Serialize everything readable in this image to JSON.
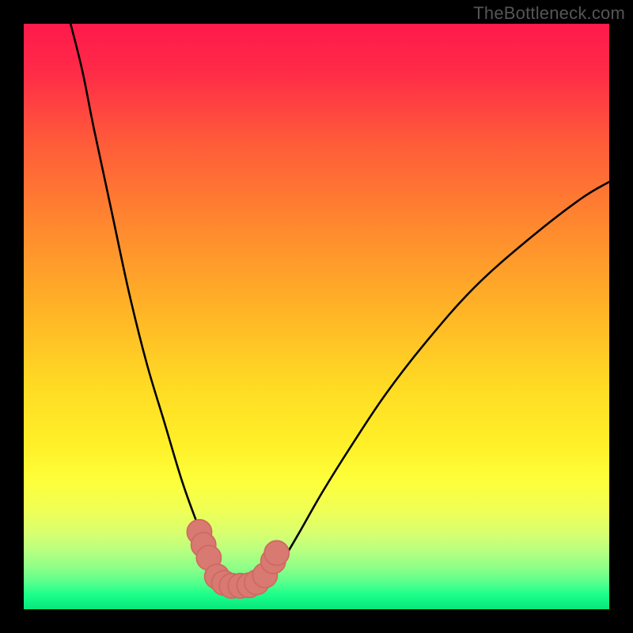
{
  "watermark": "TheBottleneck.com",
  "colors": {
    "frame": "#000000",
    "curve": "#000000",
    "marker_fill": "#d87a72",
    "marker_stroke": "#cf6a62",
    "gradient_stops": [
      {
        "offset": 0.0,
        "color": "#ff1a4b"
      },
      {
        "offset": 0.08,
        "color": "#ff2a48"
      },
      {
        "offset": 0.2,
        "color": "#ff5a3a"
      },
      {
        "offset": 0.35,
        "color": "#ff8a2e"
      },
      {
        "offset": 0.5,
        "color": "#ffb726"
      },
      {
        "offset": 0.62,
        "color": "#ffdb24"
      },
      {
        "offset": 0.72,
        "color": "#fff028"
      },
      {
        "offset": 0.78,
        "color": "#fdff3a"
      },
      {
        "offset": 0.83,
        "color": "#f0ff55"
      },
      {
        "offset": 0.87,
        "color": "#d8ff70"
      },
      {
        "offset": 0.9,
        "color": "#b8ff80"
      },
      {
        "offset": 0.93,
        "color": "#8cff88"
      },
      {
        "offset": 0.955,
        "color": "#55ff8c"
      },
      {
        "offset": 0.975,
        "color": "#1aff8a"
      },
      {
        "offset": 1.0,
        "color": "#07e77a"
      }
    ]
  },
  "chart_data": {
    "type": "line",
    "title": "",
    "xlabel": "",
    "ylabel": "",
    "xlim": [
      0,
      100
    ],
    "ylim": [
      0,
      100
    ],
    "series": [
      {
        "name": "left-curve",
        "x": [
          8,
          10,
          12,
          15,
          18,
          21,
          24,
          27,
          29.5,
          31.5,
          33,
          34,
          35,
          36,
          37.5
        ],
        "y": [
          100,
          92,
          82,
          68,
          54,
          42,
          32,
          22,
          15,
          10,
          7,
          5.5,
          4.5,
          4,
          4
        ]
      },
      {
        "name": "right-curve",
        "x": [
          37.5,
          39,
          40.5,
          42,
          44,
          47,
          51,
          56,
          62,
          69,
          77,
          86,
          95,
          100
        ],
        "y": [
          4,
          4,
          4.5,
          5.5,
          8,
          13,
          20,
          28,
          37,
          46,
          55,
          63,
          70,
          73
        ]
      }
    ],
    "markers": {
      "name": "valley-markers",
      "points": [
        {
          "x": 30.0,
          "y": 13.2
        },
        {
          "x": 30.7,
          "y": 11.0
        },
        {
          "x": 31.6,
          "y": 8.8
        },
        {
          "x": 33.0,
          "y": 5.6
        },
        {
          "x": 34.2,
          "y": 4.5
        },
        {
          "x": 35.5,
          "y": 4.0
        },
        {
          "x": 37.0,
          "y": 4.0
        },
        {
          "x": 38.5,
          "y": 4.1
        },
        {
          "x": 39.8,
          "y": 4.6
        },
        {
          "x": 41.2,
          "y": 5.8
        },
        {
          "x": 42.6,
          "y": 8.2
        },
        {
          "x": 43.2,
          "y": 9.6
        }
      ],
      "radius": 2.1
    }
  }
}
